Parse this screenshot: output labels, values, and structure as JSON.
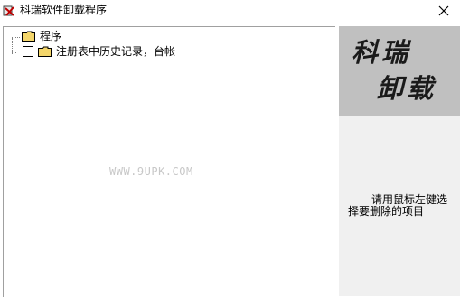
{
  "window": {
    "title": "科瑞软件卸载程序"
  },
  "tree": {
    "root_label": "程序",
    "items": [
      {
        "label": "注册表中历史记录，台帐",
        "checked": false
      }
    ]
  },
  "watermark": "WWW.9UPK.COM",
  "logo": {
    "line1": "科瑞",
    "line2": "卸载"
  },
  "hint": "请用鼠标左健选择要删除的项目",
  "icons": {
    "app": "uninstall-app-icon",
    "close": "close-icon",
    "folder": "folder-icon"
  },
  "colors": {
    "folder_fill": "#f4d66b",
    "logo_bg": "#c0c0c0",
    "panel_bg": "#f0f0f0"
  }
}
